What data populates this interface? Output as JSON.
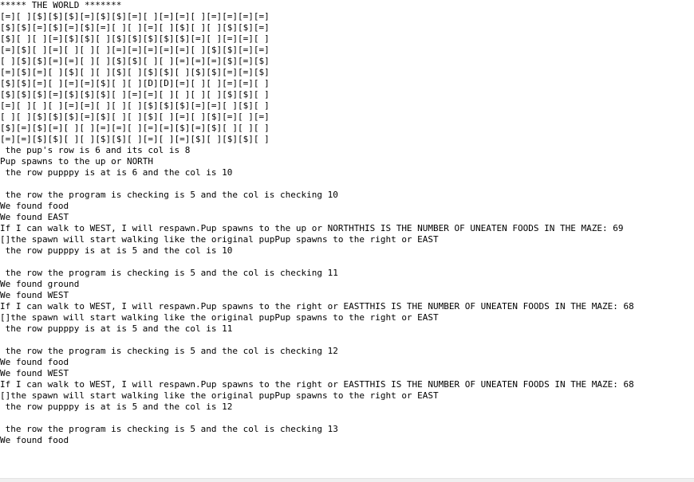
{
  "console": {
    "lines": [
      "***** THE WORLD *******",
      "[=][ ][$][$][$][=][$][$][=][ ][=][=][ ][=][=][=][=]",
      "[$][$][=][$][=][$][=][ ][ ][=][ ][$][ ][ ][$][$][=]",
      "[$][ ][ ][=][$][$][ ][$][$][$][$][$][=][ ][=][=][ ]",
      "[=][$][ ][=][ ][ ][ ][=][=][=][=][=][ ][$][$][=][=]",
      "[ ][$][$][=][=][ ][ ][$][$][ ][ ][=][=][=][$][=][$]",
      "[=][$][=][ ][$][ ][ ][$][ ][$][$][ ][$][$][=][=][$]",
      "[$][$][=][ ][=][=][$][ ][ ][D][D][=][ ][ ][=][=][ ]",
      "[$][$][$][=][$][$][$][ ][=][=][ ][ ][ ][ ][$][$][ ]",
      "[=][ ][ ][ ][=][=][ ][ ][ ][$][$][$][=][=][ ][$][ ]",
      "[ ][ ][$][$][$][=][$][ ][ ][$][ ][=][ ][$][=][ ][=]",
      "[$][=][$][=][ ][ ][=][=][ ][=][=][$][=][$][ ][ ][ ]",
      "[=][=][$][$][ ][ ][$][$][ ][=][ ][=][$][ ][$][$][ ]",
      " the pup's row is 6 and its col is 8",
      "Pup spawns to the up or NORTH",
      " the row pupppy is at is 6 and the col is 10",
      "",
      " the row the program is checking is 5 and the col is checking 10",
      "We found food",
      "We found EAST",
      "If I can walk to WEST, I will respawn.Pup spawns to the up or NORTHTHIS IS THE NUMBER OF UNEATEN FOODS IN THE MAZE: 69",
      "[]the spawn will start walking like the original pupPup spawns to the right or EAST",
      " the row pupppy is at is 5 and the col is 10",
      "",
      " the row the program is checking is 5 and the col is checking 11",
      "We found ground",
      "We found WEST",
      "If I can walk to WEST, I will respawn.Pup spawns to the right or EASTTHIS IS THE NUMBER OF UNEATEN FOODS IN THE MAZE: 68",
      "[]the spawn will start walking like the original pupPup spawns to the right or EAST",
      " the row pupppy is at is 5 and the col is 11",
      "",
      " the row the program is checking is 5 and the col is checking 12",
      "We found food",
      "We found WEST",
      "If I can walk to WEST, I will respawn.Pup spawns to the right or EASTTHIS IS THE NUMBER OF UNEATEN FOODS IN THE MAZE: 68",
      "[]the spawn will start walking like the original pupPup spawns to the right or EAST",
      " the row pupppy is at is 5 and the col is 12",
      "",
      " the row the program is checking is 5 and the col is checking 13",
      "We found food"
    ]
  }
}
